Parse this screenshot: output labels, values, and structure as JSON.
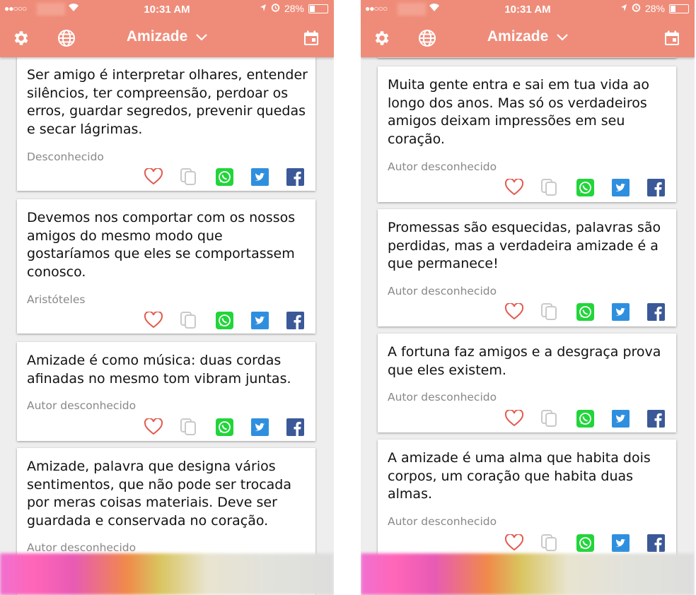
{
  "status": {
    "time": "10:31 AM",
    "battery": "28%"
  },
  "header": {
    "title": "Amizade"
  },
  "colors": {
    "accent": "#ef8c79",
    "heart": "#e35a4f",
    "whatsapp": "#21d53a",
    "twitter": "#2f8fdf",
    "facebook": "#3b5998"
  },
  "icons": {
    "settings": "gear-icon",
    "language": "globe-icon",
    "dropdown": "chevron-down-icon",
    "calendar": "calendar-icon"
  },
  "left": {
    "quotes": [
      {
        "text": "Ser amigo é interpretar olhares, entender silêncios, ter compreensão, perdoar os erros, guardar segredos, prevenir quedas e secar lágrimas.",
        "author": "Desconhecido"
      },
      {
        "text": "Devemos nos comportar com os nossos amigos do mesmo modo que gostaríamos que eles se comportassem conosco.",
        "author": "Aristóteles"
      },
      {
        "text": "Amizade é como música: duas cordas afinadas no mesmo tom vibram juntas.",
        "author": "Autor desconhecido"
      },
      {
        "text": "Amizade, palavra que designa vários sentimentos, que não pode ser trocada por meras coisas materiais. Deve ser guardada e conservada no coração.",
        "author": "Autor desconhecido"
      }
    ]
  },
  "right": {
    "quotes": [
      {
        "text": "Muita gente entra e sai em tua vida ao longo dos anos. Mas só os verdadeiros amigos deixam impressões em seu coração.",
        "author": "Autor desconhecido"
      },
      {
        "text": "Promessas são esquecidas, palavras são perdidas, mas a verdadeira amizade é a que permanece!",
        "author": "Autor desconhecido"
      },
      {
        "text": "A fortuna faz amigos e a desgraça prova que eles existem.",
        "author": "Autor desconhecido"
      },
      {
        "text": "A amizade é uma alma que habita dois corpos, um coração que habita duas almas.",
        "author": "Autor desconhecido"
      }
    ]
  }
}
